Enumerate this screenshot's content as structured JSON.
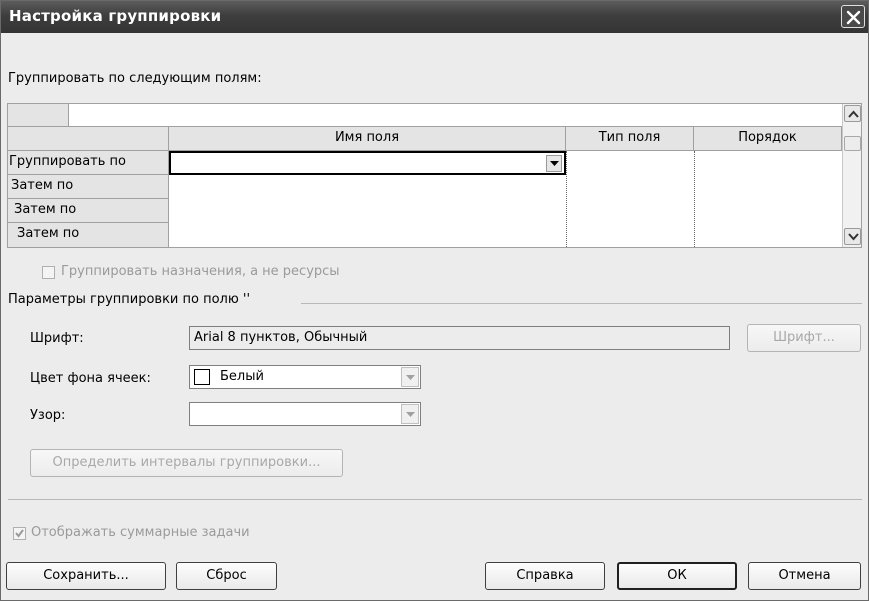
{
  "window": {
    "title": "Настройка группировки"
  },
  "section_label": "Группировать по следующим полям:",
  "grid": {
    "columns": [
      "Имя поля",
      "Тип поля",
      "Порядок"
    ],
    "rows": [
      {
        "label": "Группировать по",
        "field": "",
        "type": "",
        "order": ""
      },
      {
        "label": "Затем по",
        "field": "",
        "type": "",
        "order": ""
      },
      {
        "label": "Затем по",
        "field": "",
        "type": "",
        "order": ""
      },
      {
        "label": "Затем по",
        "field": "",
        "type": "",
        "order": ""
      }
    ]
  },
  "group_assignments": {
    "label": "Группировать назначения, а не ресурсы",
    "checked": false,
    "enabled": false
  },
  "params": {
    "title": "Параметры группировки по полю ''",
    "font_label": "Шрифт:",
    "font_value": "Arial 8 пунктов, Обычный",
    "font_button": "Шрифт...",
    "bg_label": "Цвет фона ячеек:",
    "bg_value": "Белый",
    "bg_swatch_color": "#ffffff",
    "pattern_label": "Узор:",
    "pattern_value": "",
    "intervals_button": "Определить интервалы группировки..."
  },
  "show_summary": {
    "label": "Отображать суммарные задачи",
    "checked": true,
    "enabled": false
  },
  "buttons": {
    "save": "Сохранить...",
    "reset": "Сброс",
    "help": "Справка",
    "ok": "ОК",
    "cancel": "Отмена"
  }
}
